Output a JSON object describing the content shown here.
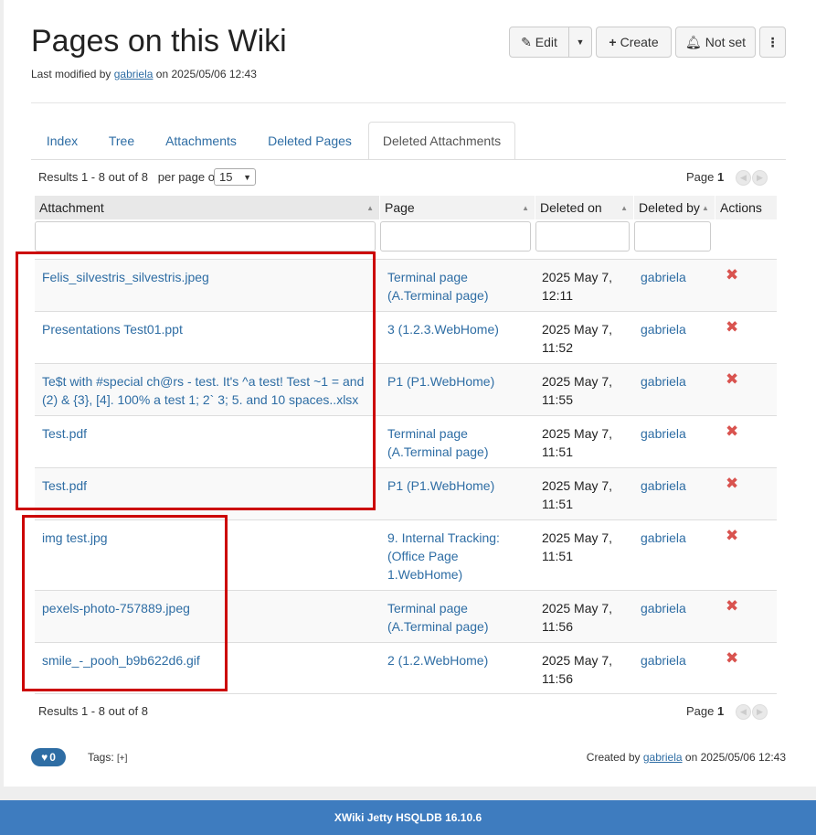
{
  "page": {
    "title": "Pages on this Wiki",
    "modified_prefix": "Last modified by",
    "modified_user": "gabriela",
    "modified_suffix": "on 2025/05/06 12:43"
  },
  "toolbar": {
    "edit_label": "Edit",
    "create_label": "Create",
    "notify_label": "Not set"
  },
  "tabs": [
    {
      "label": "Index"
    },
    {
      "label": "Tree"
    },
    {
      "label": "Attachments"
    },
    {
      "label": "Deleted Pages"
    },
    {
      "label": "Deleted Attachments",
      "active": true
    }
  ],
  "pagination": {
    "results_text": "Results 1 - 8 out of 8",
    "per_page_label": "per page of",
    "per_page_value": "15",
    "page_label": "Page",
    "page_number": "1"
  },
  "table": {
    "headers": [
      "Attachment",
      "Page",
      "Deleted on",
      "Deleted by",
      "Actions"
    ],
    "rows": [
      {
        "attachment": "Felis_silvestris_silvestris.jpeg",
        "page": [
          "Terminal page",
          "(A.Terminal page)"
        ],
        "date": [
          "2025 May 7,",
          "12:11"
        ],
        "user": "gabriela"
      },
      {
        "attachment": "Presentations Test01.ppt",
        "page": [
          "3 (1.2.3.WebHome)"
        ],
        "date": [
          "2025 May 7,",
          "11:52"
        ],
        "user": "gabriela"
      },
      {
        "attachment": "Te$t with #special ch@rs - test. It's ^a test! Test ~1 = and (2) & {3}, [4]. 100% a test 1; 2` 3; 5. and 10 spaces..xlsx",
        "attachment_lines": [
          "Te$t with #special ch@rs - test. It's ^a test! Test ~1 = and",
          "(2) & {3}, [4]. 100% a test 1; 2` 3; 5. and 10 spaces..xlsx"
        ],
        "page": [
          "P1 (P1.WebHome)"
        ],
        "date": [
          "2025 May 7,",
          "11:55"
        ],
        "user": "gabriela"
      },
      {
        "attachment": "Test.pdf",
        "page": [
          "Terminal page",
          "(A.Terminal page)"
        ],
        "date": [
          "2025 May 7,",
          "11:51"
        ],
        "user": "gabriela"
      },
      {
        "attachment": "Test.pdf",
        "page": [
          "P1 (P1.WebHome)"
        ],
        "date": [
          "2025 May 7,",
          "11:51"
        ],
        "user": "gabriela"
      },
      {
        "attachment": "img test.jpg",
        "page": [
          "9. Internal Tracking:",
          "(Office Page",
          "1.WebHome)"
        ],
        "date": [
          "2025 May 7,",
          "11:51"
        ],
        "user": "gabriela"
      },
      {
        "attachment": "pexels-photo-757889.jpeg",
        "page": [
          "Terminal page",
          "(A.Terminal page)"
        ],
        "date": [
          "2025 May 7,",
          "11:56"
        ],
        "user": "gabriela"
      },
      {
        "attachment": "smile_-_pooh_b9b622d6.gif",
        "page": [
          "2 (1.2.WebHome)"
        ],
        "date": [
          "2025 May 7,",
          "11:56"
        ],
        "user": "gabriela"
      }
    ]
  },
  "footer": {
    "likes": "0",
    "tags_label": "Tags:",
    "tags_add": "[+]",
    "created_prefix": "Created by",
    "created_user": "gabriela",
    "created_suffix": "on 2025/05/06 12:43"
  },
  "bottom": {
    "version": "XWiki Jetty HSQLDB 16.10.6"
  },
  "colors": {
    "link": "#2e6da4",
    "delete": "#d9534f",
    "highlight": "#cc0000",
    "bottom_bar": "#3e7cbf"
  }
}
